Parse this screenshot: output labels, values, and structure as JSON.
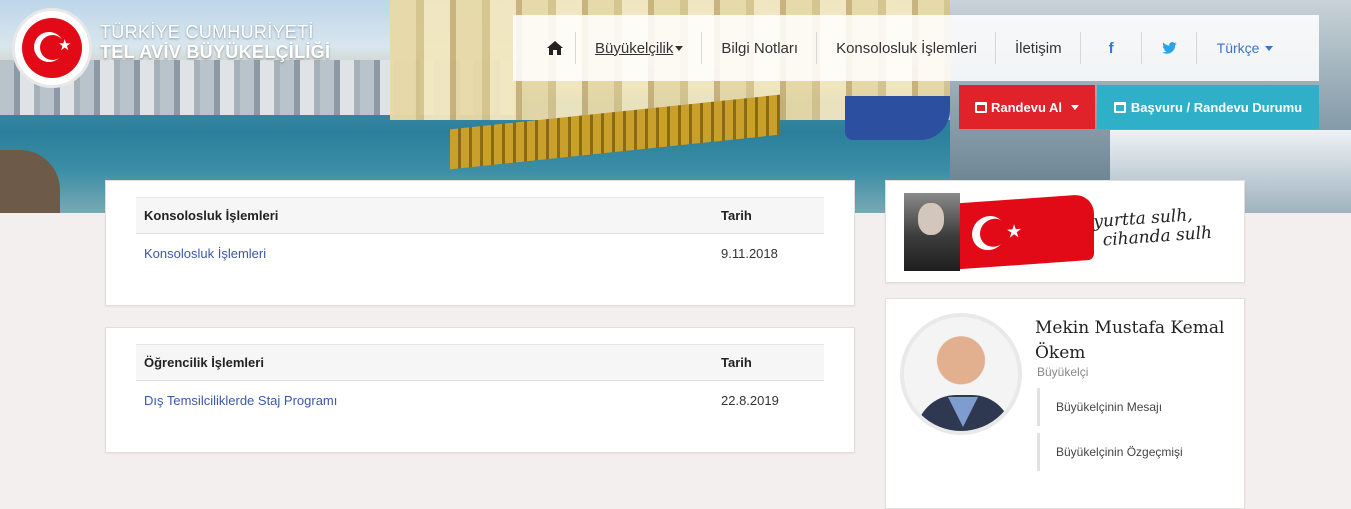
{
  "brand": {
    "line1": "TÜRKİYE CUMHURİYETİ",
    "line2": "TEL AVİV BÜYÜKELÇİLİĞİ"
  },
  "nav": {
    "home_icon": "home-icon",
    "items": [
      "Büyükelçilik",
      "Bilgi Notları",
      "Konsolosluk İşlemleri",
      "İletişim"
    ],
    "facebook_icon": "f",
    "language": "Türkçe"
  },
  "actions": {
    "appointment": "Randevu Al",
    "status": "Başvuru / Randevu Durumu"
  },
  "consular": {
    "header": {
      "col1": "Konsolosluk İşlemleri",
      "col2": "Tarih"
    },
    "rows": [
      {
        "title": "Konsolosluk İşlemleri",
        "date": "9.11.2018"
      }
    ]
  },
  "student": {
    "header": {
      "col1": "Öğrencilik İşlemleri",
      "col2": "Tarih"
    },
    "rows": [
      {
        "title": "Dış Temsilciliklerde Staj Programı",
        "date": "22.8.2019"
      }
    ]
  },
  "banner": {
    "motto_line1": "yurtta sulh,",
    "motto_line2": "cihanda sulh"
  },
  "ambassador": {
    "name": "Mekin Mustafa Kemal Ökem",
    "title": "Büyükelçi",
    "links": [
      "Büyükelçinin Mesajı",
      "Büyükelçinin Özgeçmişi"
    ]
  },
  "colors": {
    "accent_red": "#e0222b",
    "accent_teal": "#2fb0c8",
    "link_blue": "#3d57a8"
  }
}
